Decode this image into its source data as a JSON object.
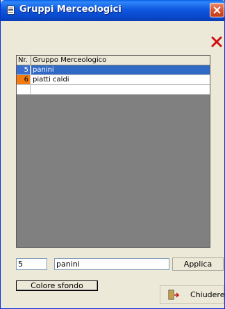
{
  "window": {
    "title": "Gruppi Merceologici"
  },
  "grid": {
    "columns": [
      "Nr.",
      "Gruppo Merceologico"
    ],
    "rows": [
      {
        "nr": "5",
        "name": "panini",
        "selected": true,
        "color": "#3a6fcf"
      },
      {
        "nr": "6",
        "name": "piatti caldi",
        "selected": false,
        "color": "#f47b0f"
      },
      {
        "nr": "",
        "name": "",
        "selected": false,
        "color": ""
      }
    ]
  },
  "form": {
    "nr_value": "5",
    "name_value": "panini",
    "apply_label": "Applica",
    "color_label": "Colore sfondo",
    "close_label": "Chiudere"
  },
  "icons": {
    "title": "list-window-icon",
    "delete": "red-x-icon",
    "close_window": "close-icon",
    "exit": "door-exit-icon"
  }
}
